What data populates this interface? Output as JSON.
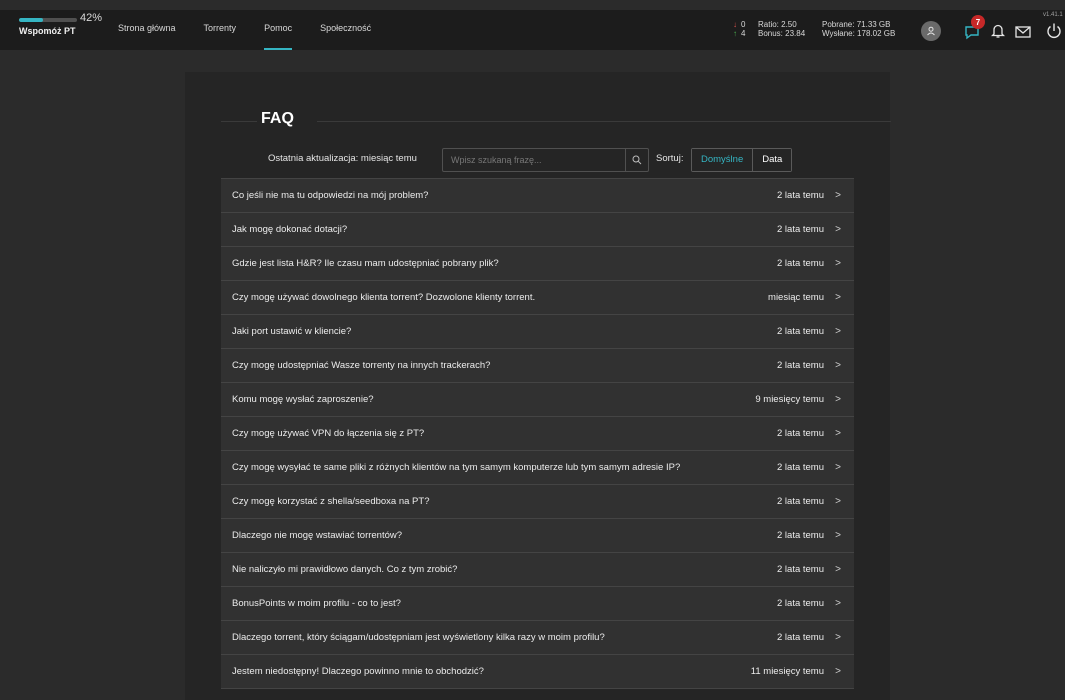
{
  "support": {
    "label": "Wspomóż PT",
    "percent_text": "42%",
    "progress": 0.42
  },
  "nav": {
    "items": [
      {
        "label": "Strona główna",
        "active": false
      },
      {
        "label": "Torrenty",
        "active": false
      },
      {
        "label": "Pomoc",
        "active": true
      },
      {
        "label": "Społeczność",
        "active": false
      }
    ]
  },
  "stats": {
    "down_count": "0",
    "up_count": "4",
    "ratio": "Ratio: 2.50",
    "bonus": "Bonus: 23.84",
    "downloaded": "Pobrane: 71.33 GB",
    "uploaded": "Wysłane: 178.02 GB"
  },
  "header": {
    "messages_badge": "7",
    "version": "v1.41.1"
  },
  "faq": {
    "title": "FAQ",
    "last_update": "Ostatnia aktualizacja: miesiąc temu",
    "search_placeholder": "Wpisz szukaną frazę...",
    "sort_label": "Sortuj:",
    "sort_options": [
      "Domyślne",
      "Data"
    ],
    "items": [
      {
        "question": "Co jeśli nie ma tu odpowiedzi na mój problem?",
        "date": "2 lata temu"
      },
      {
        "question": "Jak mogę dokonać dotacji?",
        "date": "2 lata temu"
      },
      {
        "question": "Gdzie jest lista H&R? Ile czasu mam udostępniać pobrany plik?",
        "date": "2 lata temu"
      },
      {
        "question": "Czy mogę używać dowolnego klienta torrent? Dozwolone klienty torrent.",
        "date": "miesiąc temu"
      },
      {
        "question": "Jaki port ustawić w kliencie?",
        "date": "2 lata temu"
      },
      {
        "question": "Czy mogę udostępniać Wasze torrenty na innych trackerach?",
        "date": "2 lata temu"
      },
      {
        "question": "Komu mogę wysłać zaproszenie?",
        "date": "9 miesięcy temu"
      },
      {
        "question": "Czy mogę używać VPN do łączenia się z PT?",
        "date": "2 lata temu"
      },
      {
        "question": "Czy mogę wysyłać te same pliki z różnych klientów na tym samym komputerze lub tym samym adresie IP?",
        "date": "2 lata temu"
      },
      {
        "question": "Czy mogę korzystać z shella/seedboxa na PT?",
        "date": "2 lata temu"
      },
      {
        "question": "Dlaczego nie mogę wstawiać torrentów?",
        "date": "2 lata temu"
      },
      {
        "question": "Nie naliczyło mi prawidłowo danych. Co z tym zrobić?",
        "date": "2 lata temu"
      },
      {
        "question": "BonusPoints w moim profilu - co to jest?",
        "date": "2 lata temu"
      },
      {
        "question": "Dlaczego torrent, który ściągam/udostępniam jest wyświetlony kilka razy w moim profilu?",
        "date": "2 lata temu"
      },
      {
        "question": "Jestem niedostępny! Dlaczego powinno mnie to obchodzić?",
        "date": "11 miesięcy temu"
      }
    ]
  }
}
